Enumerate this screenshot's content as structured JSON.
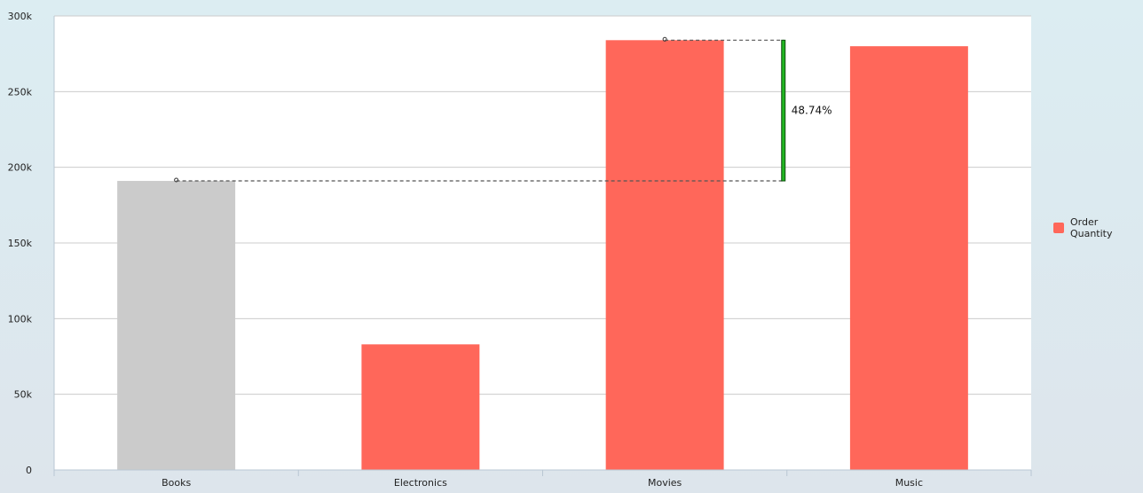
{
  "chart_data": {
    "type": "bar",
    "categories": [
      "Books",
      "Electronics",
      "Movies",
      "Music"
    ],
    "series": [
      {
        "name": "Order Quantity",
        "values": [
          191000,
          83000,
          284000,
          280000
        ]
      }
    ],
    "highlighted_category": "Books",
    "ylim": [
      0,
      300000
    ],
    "yticks": [
      0,
      50000,
      100000,
      150000,
      200000,
      250000,
      300000
    ],
    "ytick_labels": [
      "0",
      "50k",
      "100k",
      "150k",
      "200k",
      "250k",
      "300k"
    ],
    "grid": true,
    "legend_position": "right",
    "annotation": {
      "from_category": "Books",
      "to_category": "Movies",
      "label": "48.74%"
    },
    "colors": {
      "bar": "#ff675a",
      "highlight": "#cbcbcb",
      "annotation": "#22b522"
    }
  }
}
